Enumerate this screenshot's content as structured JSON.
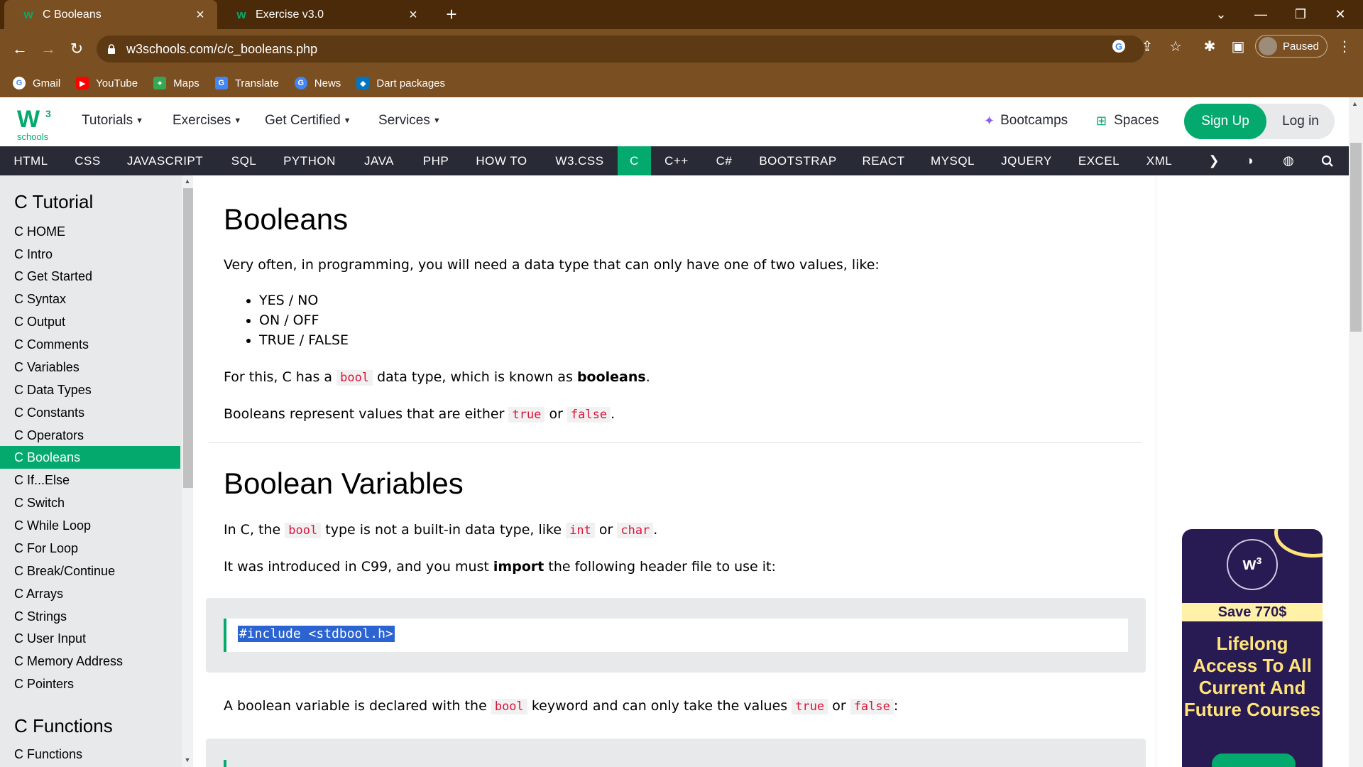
{
  "browser": {
    "tabs": [
      {
        "title": "C Booleans",
        "active": true
      },
      {
        "title": "Exercise v3.0",
        "active": false
      }
    ],
    "url": "w3schools.com/c/c_booleans.php",
    "profile_label": "Paused",
    "bookmarks": [
      "Gmail",
      "YouTube",
      "Maps",
      "Translate",
      "News",
      "Dart packages"
    ]
  },
  "header": {
    "logo_text": "schools",
    "menus": [
      "Tutorials",
      "Exercises",
      "Get Certified",
      "Services"
    ],
    "bootcamps": "Bootcamps",
    "spaces": "Spaces",
    "signup": "Sign Up",
    "login": "Log in"
  },
  "topnav": [
    "HTML",
    "CSS",
    "JAVASCRIPT",
    "SQL",
    "PYTHON",
    "JAVA",
    "PHP",
    "HOW TO",
    "W3.CSS",
    "C",
    "C++",
    "C#",
    "BOOTSTRAP",
    "REACT",
    "MYSQL",
    "JQUERY",
    "EXCEL",
    "XML"
  ],
  "sidebar": {
    "heading": "C Tutorial",
    "items": [
      "C HOME",
      "C Intro",
      "C Get Started",
      "C Syntax",
      "C Output",
      "C Comments",
      "C Variables",
      "C Data Types",
      "C Constants",
      "C Operators",
      "C Booleans",
      "C If...Else",
      "C Switch",
      "C While Loop",
      "C For Loop",
      "C Break/Continue",
      "C Arrays",
      "C Strings",
      "C User Input",
      "C Memory Address",
      "C Pointers"
    ],
    "heading2": "C Functions",
    "items2": [
      "C Functions"
    ]
  },
  "content": {
    "h1": "Booleans",
    "intro": "Very often, in programming, you will need a data type that can only have one of two values, like:",
    "list": [
      "YES / NO",
      "ON / OFF",
      "TRUE / FALSE"
    ],
    "p1_a": "For this, C has a ",
    "p1_code": "bool",
    "p1_b": " data type, which is known as ",
    "p1_bold": "booleans",
    "p1_c": ".",
    "p2_a": "Booleans represent values that are either ",
    "p2_true": "true",
    "p2_or": " or ",
    "p2_false": "false",
    "p2_end": ".",
    "h2": "Boolean Variables",
    "p3_a": "In C, the ",
    "p3_bool": "bool",
    "p3_b": " type is not a built-in data type, like ",
    "p3_int": "int",
    "p3_or": " or ",
    "p3_char": "char",
    "p3_end": ".",
    "p4_a": "It was introduced in C99, and you must ",
    "p4_bold": "import",
    "p4_b": " the following header file to use it:",
    "code1": "#include <stdbool.h>",
    "p5_a": "A boolean variable is declared with the ",
    "p5_bool": "bool",
    "p5_b": " keyword and can only take the values ",
    "p5_true": "true",
    "p5_or": " or ",
    "p5_false": "false",
    "p5_end": ":"
  },
  "ad": {
    "save": "Save 770$",
    "headline": "Lifelong Access To All Current And Future Courses"
  },
  "colors": {
    "accent": "#04aa6d",
    "nav_dark": "#282a35",
    "chrome": "#7a4f22",
    "code_red": "#dc143c"
  }
}
